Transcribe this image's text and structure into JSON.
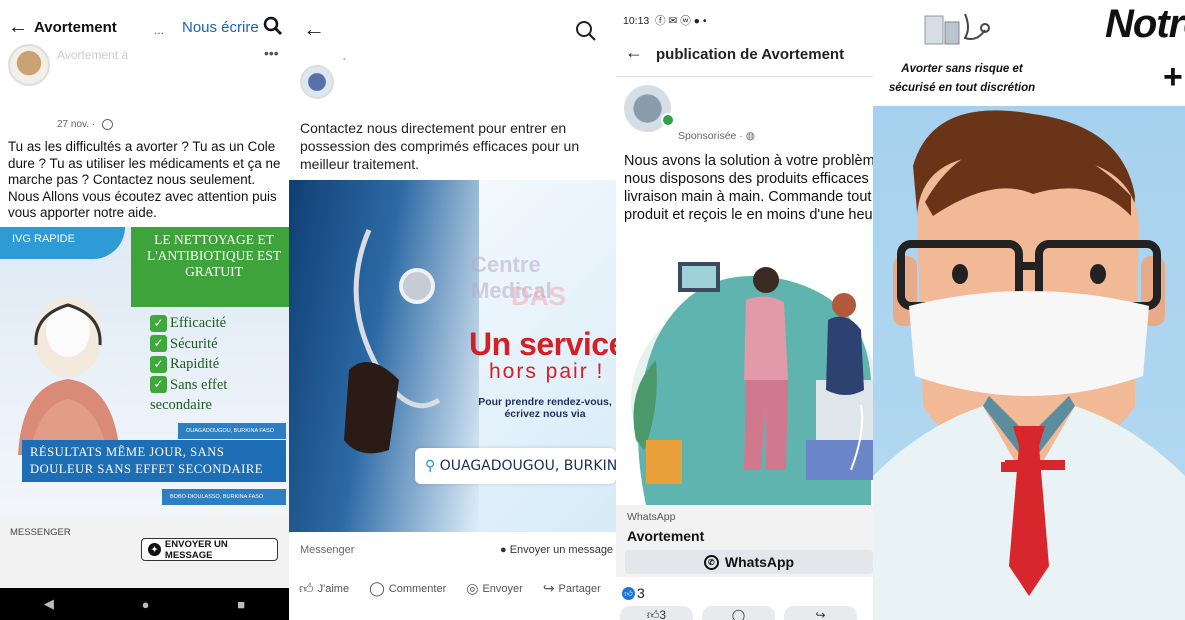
{
  "panel1": {
    "header_title": "Avortement",
    "header_ellipsis": "...",
    "write_link": "Nous écrire",
    "page_name": "Avortement à",
    "date": "27 nov. ·",
    "post_text": "Tu as les difficultés a avorter ? Tu as un Cole dure ? Tu as utiliser les médicaments et ça ne marche pas ? Contactez nous seulement. Nous Allons vous écoutez avec attention puis vous apporter notre aide.",
    "image": {
      "badge": "IVG RAPIDE",
      "green_box": "LE NETTOYAGE ET L'ANTIBIOTIQUE EST GRATUIT",
      "checks": [
        "Efficacité",
        "Sécurité",
        "Rapidité",
        "Sans effet",
        "secondaire"
      ],
      "location_1": "OUAGADOUGOU, BURKINA FASO",
      "blue_line_1": "RÉSULTATS MÊME  JOUR, SANS",
      "blue_line_2": "DOULEUR SANS  EFFET SECONDAIRE",
      "location_2": "BOBO-DIOULASSO, BURKINA FASO"
    },
    "footer_label": "MESSENGER",
    "cta_button": "ENVOYER UN MESSAGE"
  },
  "panel2": {
    "post_text": "Contactez nous directement pour entrer en possession des comprimés efficaces pour un meilleur traitement.",
    "image": {
      "headline": "Un service",
      "subheadline": "hors pair !",
      "rdv": "Pour prendre rendez-vous, écrivez nous via",
      "location": "OUAGADOUGOU, BURKINA FASO"
    },
    "footer_label": "Messenger",
    "send_label": "Envoyer un message",
    "actions": [
      "J'aime",
      "Commenter",
      "Envoyer",
      "Partager"
    ]
  },
  "panel3": {
    "status_time": "10:13",
    "status_icons": "ⓕ ✉ ⓦ ● •",
    "title": "publication de Avortement",
    "sponsored": "Sponsorisée ·",
    "post_lines": [
      "Nous avons la solution à votre problème",
      "nous disposons des produits efficaces",
      "livraison main à main. Commande tout",
      "produit et reçois le en moins d'une heure"
    ],
    "card_label": "WhatsApp",
    "card_name": "Avortement",
    "wa_button": "WhatsApp",
    "reaction_count": "3",
    "pill_count": "3"
  },
  "panel4": {
    "tagline": "Avorter sans risque et sécurisé en tout discrétion",
    "headline": "Notre",
    "plus": "+"
  }
}
